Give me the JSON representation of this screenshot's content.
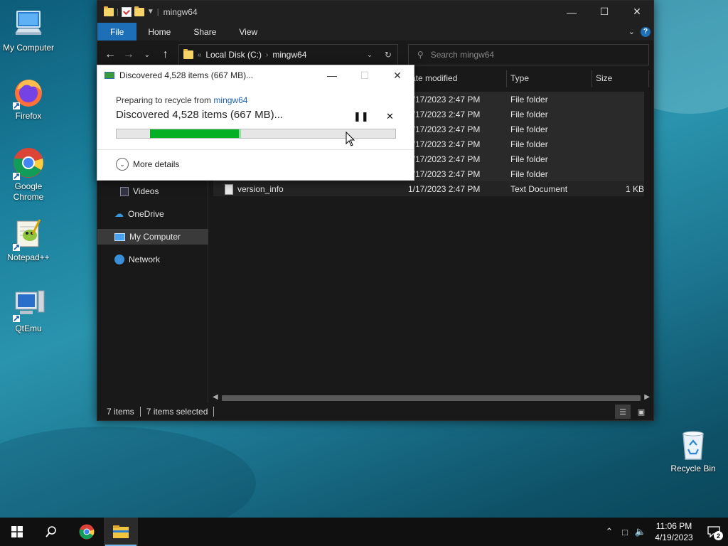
{
  "desktop": {
    "icons": [
      {
        "label": "My Computer"
      },
      {
        "label": "Firefox"
      },
      {
        "label": "Google Chrome"
      },
      {
        "label": "Notepad++"
      },
      {
        "label": "QtEmu"
      },
      {
        "label": "Recycle Bin"
      }
    ]
  },
  "explorer": {
    "title": "mingw64",
    "ribbon_tabs": [
      "File",
      "Home",
      "Share",
      "View"
    ],
    "address": {
      "crumbs": [
        "Local Disk (C:)",
        "mingw64"
      ]
    },
    "search_placeholder": "Search mingw64",
    "nav_items": [
      "Videos",
      "OneDrive",
      "My Computer",
      "Network"
    ],
    "columns": [
      "ate modified",
      "Type",
      "Size"
    ],
    "rows": [
      {
        "name": "",
        "date": "1/17/2023 2:47 PM",
        "type": "File folder",
        "size": ""
      },
      {
        "name": "",
        "date": "1/17/2023 2:47 PM",
        "type": "File folder",
        "size": ""
      },
      {
        "name": "",
        "date": "1/17/2023 2:47 PM",
        "type": "File folder",
        "size": ""
      },
      {
        "name": "",
        "date": "1/17/2023 2:47 PM",
        "type": "File folder",
        "size": ""
      },
      {
        "name": "",
        "date": "1/17/2023 2:47 PM",
        "type": "File folder",
        "size": ""
      },
      {
        "name": "",
        "date": "1/17/2023 2:47 PM",
        "type": "File folder",
        "size": ""
      },
      {
        "name": "version_info",
        "date": "1/17/2023 2:47 PM",
        "type": "Text Document",
        "size": "1 KB"
      }
    ],
    "status": {
      "items": "7 items",
      "selected": "7 items selected"
    }
  },
  "dialog": {
    "title": "Discovered 4,528 items (667 MB)...",
    "sub_prefix": "Preparing to recycle from",
    "sub_link": "mingw64",
    "main": "Discovered 4,528 items (667 MB)...",
    "more_details": "More details",
    "progress": {
      "start_fraction": 0.12,
      "end_fraction": 0.44
    }
  },
  "taskbar": {
    "time": "11:06 PM",
    "date": "4/19/2023",
    "notifications": "2"
  },
  "colors": {
    "accent": "#1d6fb8",
    "progress": "#06b025",
    "link": "#1b5fad"
  }
}
